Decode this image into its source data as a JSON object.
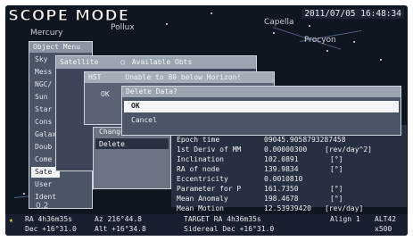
{
  "title": "SCOPE MODE",
  "datetime": "2011/07/05 16:48:34",
  "sky_labels": [
    "Pollux",
    "Mercury",
    "Capella",
    "Procyon"
  ],
  "object_menu": {
    "title": "Object Menu",
    "items": [
      "Sky",
      "Mess",
      "NGC/",
      "Sun",
      "Star",
      "Cons",
      "Galax",
      "Doub",
      "Come",
      "Sate",
      "User",
      "Ident"
    ]
  },
  "satellite_bar": {
    "label": "Satellite",
    "option": "Available Obts"
  },
  "warning": {
    "title": "HST",
    "message": "Unable to 80 below Horizon!",
    "ok": "OK"
  },
  "satellite_menu": {
    "items": [
      "Change Data",
      "Delete"
    ]
  },
  "delete_dialog": {
    "title": "Delete Data?",
    "options": [
      "OK",
      "Cancel"
    ]
  },
  "info": {
    "rows": [
      {
        "label": "Epoch time",
        "value": "09045.9058793287458",
        "unit": ""
      },
      {
        "label": "1st Deriv of MM",
        "value": "0.00000300",
        "unit": "[rev/day^2]"
      },
      {
        "label": "Inclination",
        "value": "102.0891",
        "unit": "[°]"
      },
      {
        "label": "RA of node",
        "value": "139.9834",
        "unit": "[°]"
      },
      {
        "label": "Eccentricity",
        "value": "0.0010810",
        "unit": ""
      },
      {
        "label": "Parameter for P",
        "value": "161.7350",
        "unit": "[°]"
      },
      {
        "label": "Mean Anomaly",
        "value": "198.4678",
        "unit": "[°]"
      },
      {
        "label": "Mean Motion",
        "value": "12.53939420",
        "unit": "[rev/day]"
      }
    ]
  },
  "bottom": {
    "ra": "RA   4h36m35s",
    "az": "Az  216°44.8",
    "target": "TARGET  RA 4h36m35s",
    "align": "Align 1",
    "alt_label": "ALT42",
    "dec": "Dec +16°31.0",
    "alt": "Alt +16°34.8",
    "sidereal": "Sidereal  Dec +16°31.0",
    "rate": "x500",
    "scale": "0.2"
  }
}
